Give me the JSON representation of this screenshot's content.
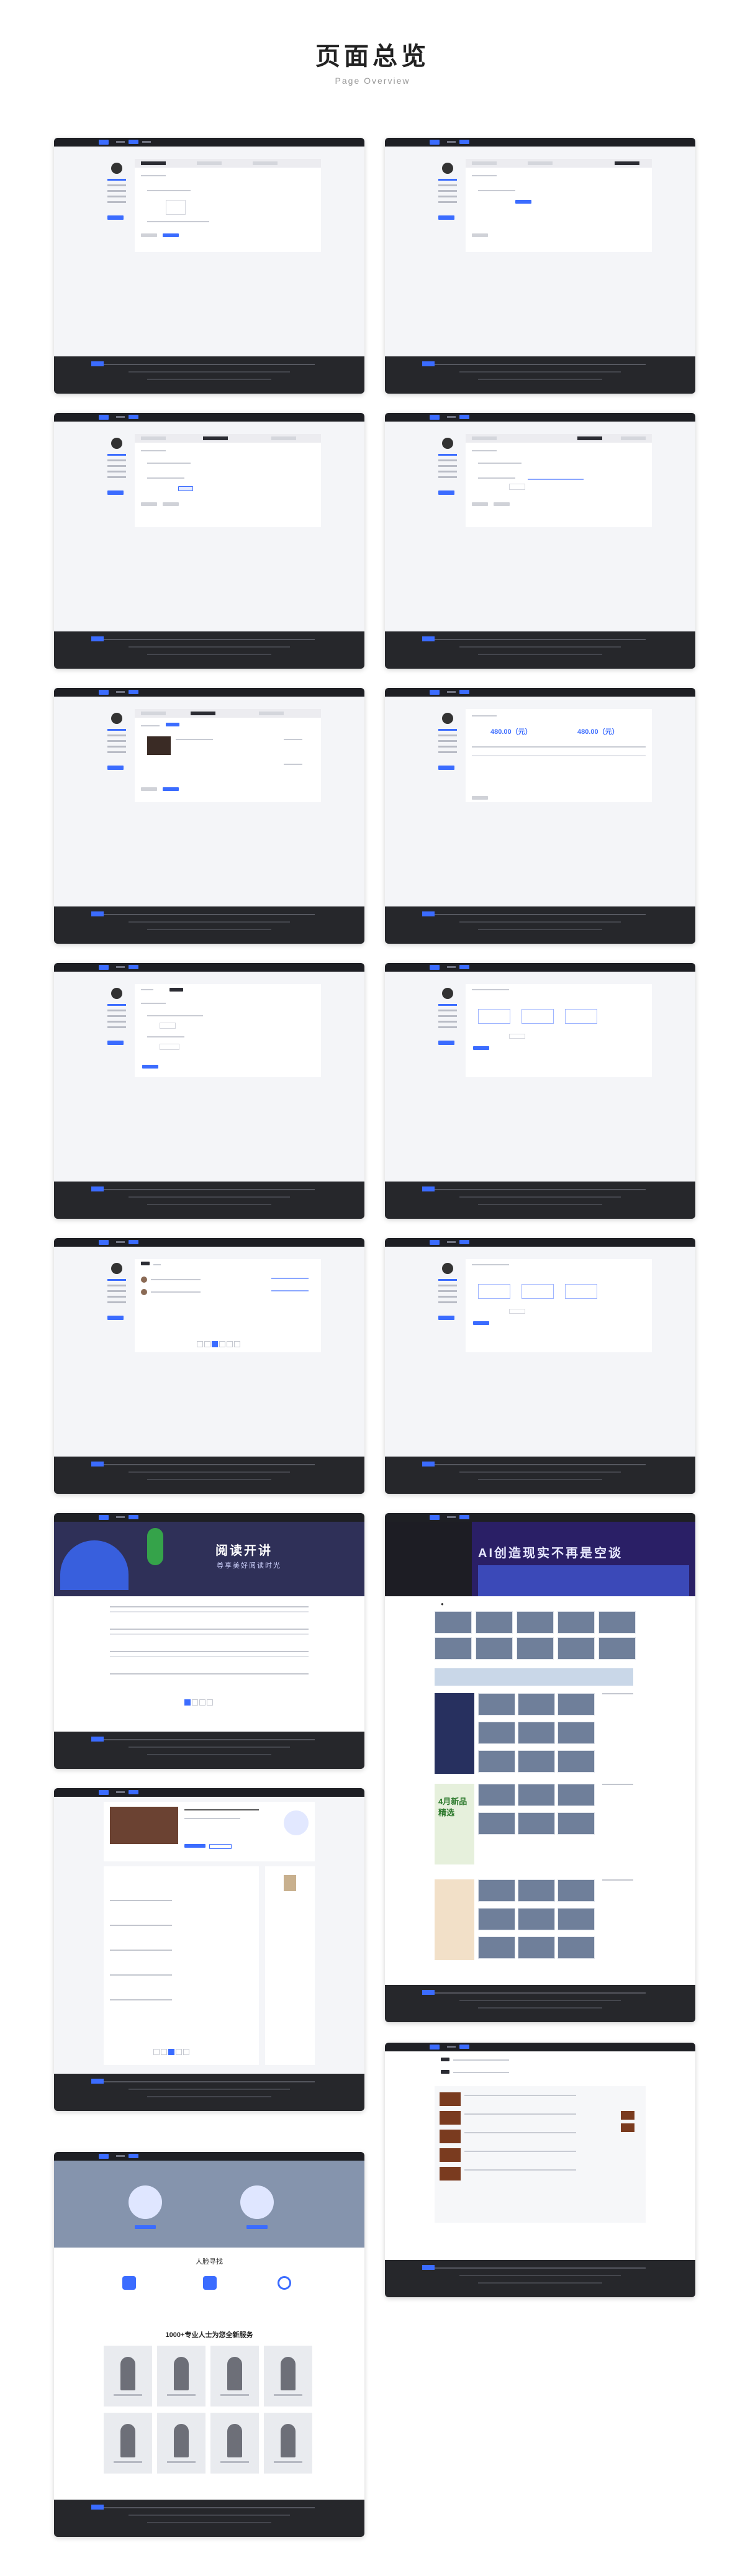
{
  "header": {
    "title": "页面总览",
    "subtitle": "Page Overview"
  },
  "screens": {
    "balance_left": "480.00（元）",
    "balance_right": "480.00（元）",
    "reading_banner_title": "阅读开讲",
    "reading_banner_sub": "尊享美好阅读时光",
    "vr_banner_title": "AI创造现实不再是空谈",
    "spring_promo": "4月新品精选",
    "consult_section_title": "1000+专业人士为您全新服务",
    "consult_heading": "人脸寻找"
  },
  "colors": {
    "accent": "#3b6cff",
    "dark": "#1e1f24",
    "footer": "#26272b"
  }
}
